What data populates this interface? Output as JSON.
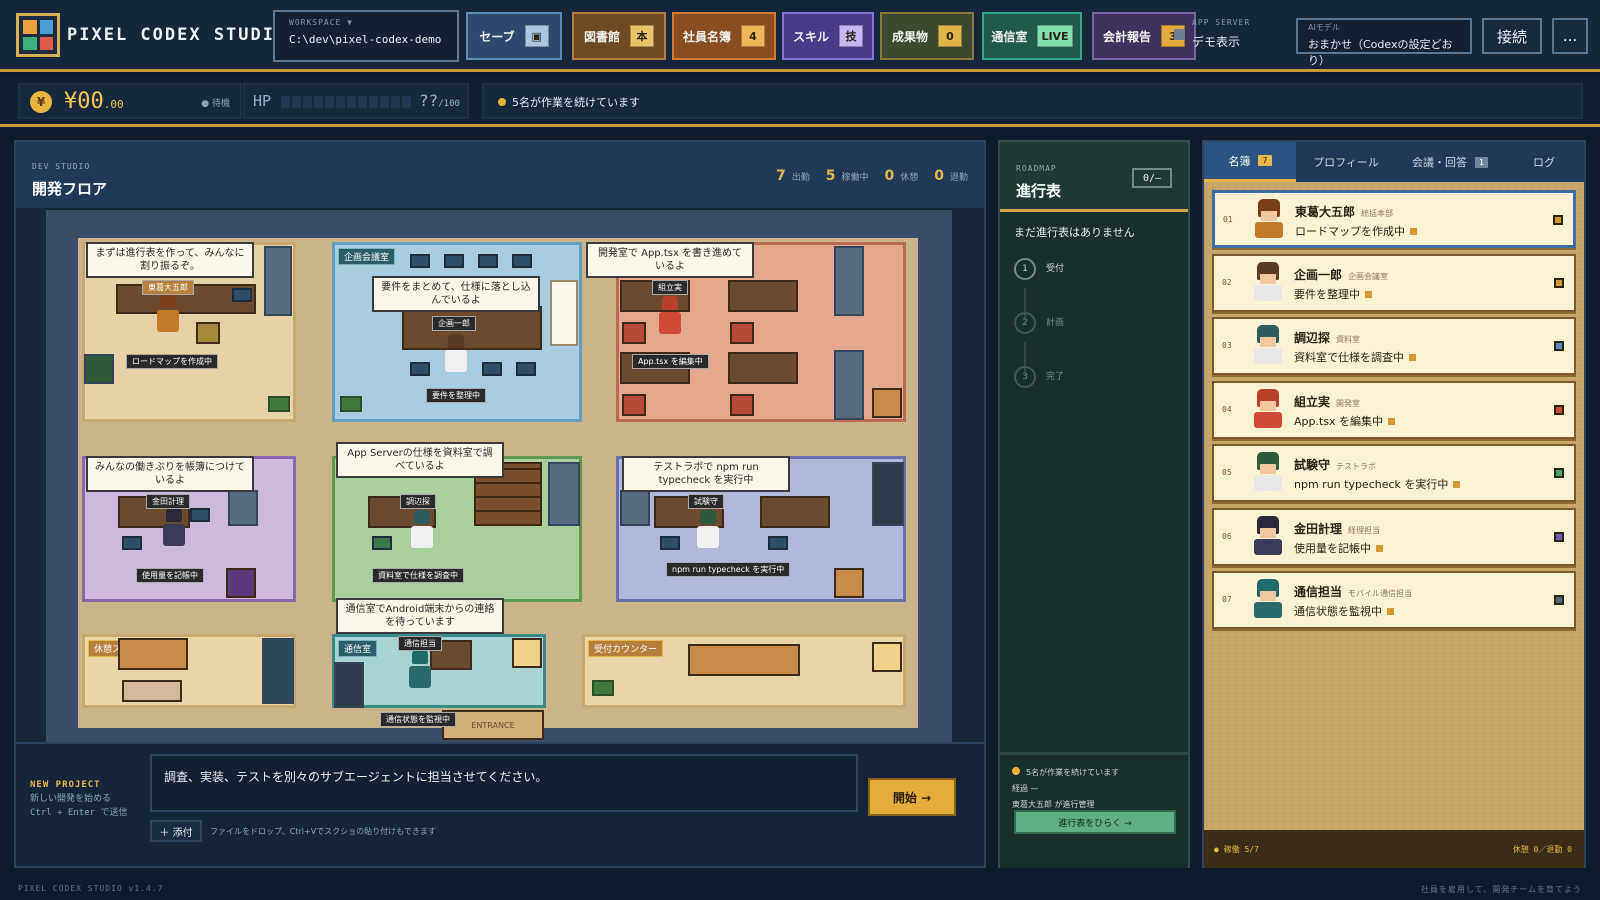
{
  "header": {
    "brand": "PIXEL CODEX STUDIO",
    "workspace_label": "WORKSPACE ▼",
    "workspace_path": "C:\\dev\\pixel-codex-demo",
    "buttons": [
      {
        "label": "セーブ",
        "badge": "▣",
        "color": "#2b4a6e",
        "border": "#5f8bb8",
        "badge_bg": "#a9c6e3"
      },
      {
        "label": "図書館",
        "badge": "本",
        "color": "#6e4a24",
        "border": "#b5803c",
        "badge_bg": "#e9c46a"
      },
      {
        "label": "社員名簿",
        "badge": "4",
        "color": "#8a4d22",
        "border": "#d07a36",
        "badge_bg": "#f0b45a"
      },
      {
        "label": "スキル",
        "badge": "技",
        "color": "#4a3a8a",
        "border": "#8a74d6",
        "badge_bg": "#c6b6f2"
      },
      {
        "label": "成果物",
        "badge": "0",
        "color": "#3b4a2f",
        "border": "#8a7a3a",
        "badge_bg": "#e0b64a"
      },
      {
        "label": "通信室",
        "badge": "LIVE",
        "color": "#1f5a4a",
        "border": "#3aa586",
        "badge_bg": "#7fe0b0"
      },
      {
        "label": "会計報告",
        "badge": "3",
        "color": "#40325e",
        "border": "#7a62a8",
        "badge_bg": "#e3a93c"
      }
    ],
    "app_server_label": "APP SERVER",
    "app_server_value": "デモ表示",
    "ai_model_label": "AIモデル",
    "ai_model_value": "おまかせ（Codexの設定どおり）",
    "connect_label": "接続",
    "more_label": "..."
  },
  "status": {
    "currency_symbol": "¥",
    "money_main": "¥00",
    "money_decimal": ".00",
    "waiting": "● 待機",
    "hp_label": "HP",
    "hp_value": "??",
    "hp_max": "/100",
    "message": "5名が作業を続けています"
  },
  "floor": {
    "section_label": "DEV STUDIO",
    "title": "開発フロア",
    "counts": [
      {
        "n": "7",
        "label": "出勤"
      },
      {
        "n": "5",
        "label": "稼働中"
      },
      {
        "n": "0",
        "label": "休憩"
      },
      {
        "n": "0",
        "label": "退勤"
      }
    ],
    "rooms": {
      "meeting": "企画会議室",
      "comm": "通信室",
      "rest": "休憩スペース",
      "reception": "受付カウンター",
      "entrance": "ENTRANCE"
    },
    "bubbles": {
      "b1": "まずは進行表を作って、みんなに割り振るぞ。",
      "b2": "要件をまとめて、仕様に落とし込んでいるよ",
      "b3": "開発室で App.tsx を書き進めているよ",
      "b4": "みんなの働きぶりを帳簿につけているよ",
      "b5": "App Serverの仕様を資料室で調べているよ",
      "b6": "テストラボで npm run typecheck を実行中",
      "b7": "通信室でAndroid端末からの連絡を待っています"
    },
    "names": {
      "n1": "東葛大五郎",
      "n2": "企画一郎",
      "n3": "組立実",
      "n4": "金田計理",
      "n5": "調辺探",
      "n6": "試験守",
      "n7": "通信担当"
    },
    "status_tags": {
      "t1": "ロードマップを作成中",
      "t2": "要件を整理中",
      "t3": "App.tsx を編集中",
      "t4": "使用量を記帳中",
      "t5": "資料室で仕様を調査中",
      "t6": "npm run typecheck を実行中",
      "t7": "通信状態を監視中"
    }
  },
  "composer": {
    "label": "NEW PROJECT",
    "sub1": "新しい開発を始める",
    "sub2": "Ctrl + Enter で送信",
    "text": "調査、実装、テストを別々のサブエージェントに担当させてください。",
    "start": "開始 →",
    "attach": "＋ 添付",
    "hint": "ファイルをドロップ、Ctrl+Vでスクショの貼り付けもできます"
  },
  "roadmap": {
    "section_label": "ROADMAP",
    "title": "進行表",
    "counter": "0/—",
    "empty": "まだ進行表はありません",
    "steps": [
      {
        "n": "1",
        "label": "受付"
      },
      {
        "n": "2",
        "label": "計画"
      },
      {
        "n": "3",
        "label": "完了"
      }
    ],
    "foot_line1": "5名が作業を続けています",
    "foot_line2": "経過 —",
    "foot_line3": "東葛大五郎 が進行管理",
    "open_btn": "進行表をひらく →"
  },
  "roster": {
    "tabs": [
      {
        "label": "名簿",
        "badge": "7"
      },
      {
        "label": "プロフィール",
        "badge": ""
      },
      {
        "label": "会議・回答",
        "badge": "1"
      },
      {
        "label": "ログ",
        "badge": ""
      }
    ],
    "members": [
      {
        "num": "01",
        "name": "東葛大五郎",
        "role": "統括本部",
        "task": "ロードマップを作成中",
        "sq": "#d39a30",
        "hair": "#7a3f1a",
        "body": "#c07a2a"
      },
      {
        "num": "02",
        "name": "企画一郎",
        "role": "企画会議室",
        "task": "要件を整理中",
        "sq": "#d39a30",
        "hair": "#5a3a22",
        "body": "#e8e8e8"
      },
      {
        "num": "03",
        "name": "調辺探",
        "role": "資料室",
        "task": "資料室で仕様を調査中",
        "sq": "#5a8ac6",
        "hair": "#2d5a5a",
        "body": "#e8e8e8"
      },
      {
        "num": "04",
        "name": "組立実",
        "role": "開発室",
        "task": "App.tsx を編集中",
        "sq": "#d04a3a",
        "hair": "#b8402a",
        "body": "#d04a3a"
      },
      {
        "num": "05",
        "name": "試験守",
        "role": "テストラボ",
        "task": "npm run typecheck を実行中",
        "sq": "#4aa86a",
        "hair": "#2d5a3a",
        "body": "#e8e8e8"
      },
      {
        "num": "06",
        "name": "金田計理",
        "role": "経理担当",
        "task": "使用量を記帳中",
        "sq": "#7a5ab8",
        "hair": "#2a2a3a",
        "body": "#3a3a5a"
      },
      {
        "num": "07",
        "name": "通信担当",
        "role": "モバイル通信担当",
        "task": "通信状態を監視中",
        "sq": "#5a6a7a",
        "hair": "#1f6a6a",
        "body": "#2a6a6a"
      }
    ],
    "foot_left": "● 稼働 5/7",
    "foot_right": "休憩 0／退勤 0"
  },
  "footer": {
    "version": "PIXEL CODEX STUDIO v1.4.7",
    "tagline": "社員を雇用して、開発チームを育てよう"
  }
}
